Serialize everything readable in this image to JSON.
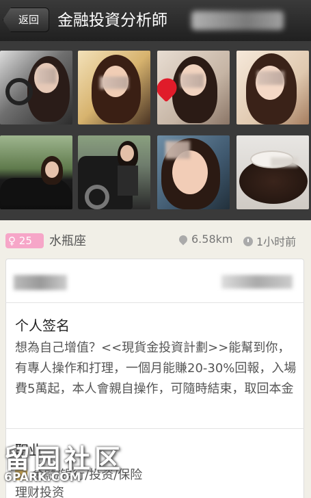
{
  "header": {
    "back_label": "返回",
    "title": "金融投資分析師"
  },
  "profile": {
    "age": "25",
    "zodiac": "水瓶座",
    "distance": "6.58km",
    "last_active": "1小时前"
  },
  "signature": {
    "heading": "个人签名",
    "text": "想為自己增值？<<現貨金投資計劃>>能幫到你，有專人操作和打理，一個月能賺20-30%回報，入場費5萬起，本人會親自操作，可隨時結束，取回本金"
  },
  "job": {
    "heading": "职业",
    "line1": "金融/银行/投资/保险",
    "line2": "理财投资"
  },
  "watermark": {
    "text": "留园社区",
    "site": "6PARK.COM"
  },
  "colors": {
    "header_bg": "#2b2b2b",
    "badge_pink": "#f6a6c8",
    "page_bg": "#f1efe7"
  }
}
